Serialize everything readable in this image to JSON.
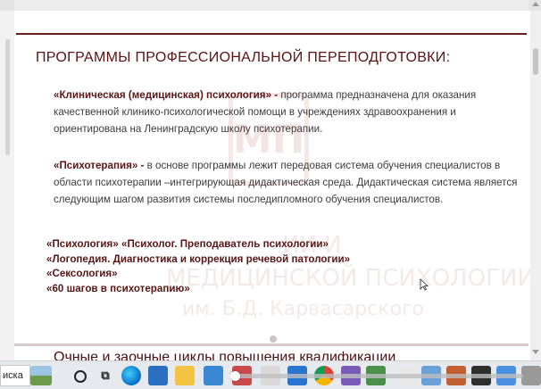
{
  "slide": {
    "title": "ПРОГРАММЫ ПРОФЕССИОНАЛЬНОЙ ПЕРЕПОДГОТОВКИ:",
    "para1": {
      "name": "«Клиническая (медицинская) психология» -",
      "text": " программа предназначена для оказания качественной клинико-психологической помощи в учреждениях здравоохранения и ориентирована на Ленинградскую школу психотерапии."
    },
    "para2": {
      "name": "«Психотерапия» -",
      "text": " в основе программы лежит передовая система обучения специалистов в области психотерапии –интегрирующая дидактическая среда. Дидактическая система является следующим шагом развития системы последипломного обучения специалистов."
    },
    "programs": [
      "«Психология»  «Психолог. Преподаватель психологии»",
      "«Логопедия. Диагностика и коррекция речевой патологии»",
      "«Сексология»",
      "«60 шагов в психотерапию»"
    ],
    "watermark": {
      "logo": "МП",
      "line1": "ИИ И",
      "line2": "МЕДИЦИНСКОЙ ПСИХОЛОГИИ",
      "line3": "им. Б.Д. Карвасарского"
    },
    "next_heading": "Очные и заочные циклы повышения квалификации"
  },
  "taskbar": {
    "search_text": "иска",
    "task_view_glyph": "⧉"
  },
  "video": {
    "progress": 0.02
  }
}
